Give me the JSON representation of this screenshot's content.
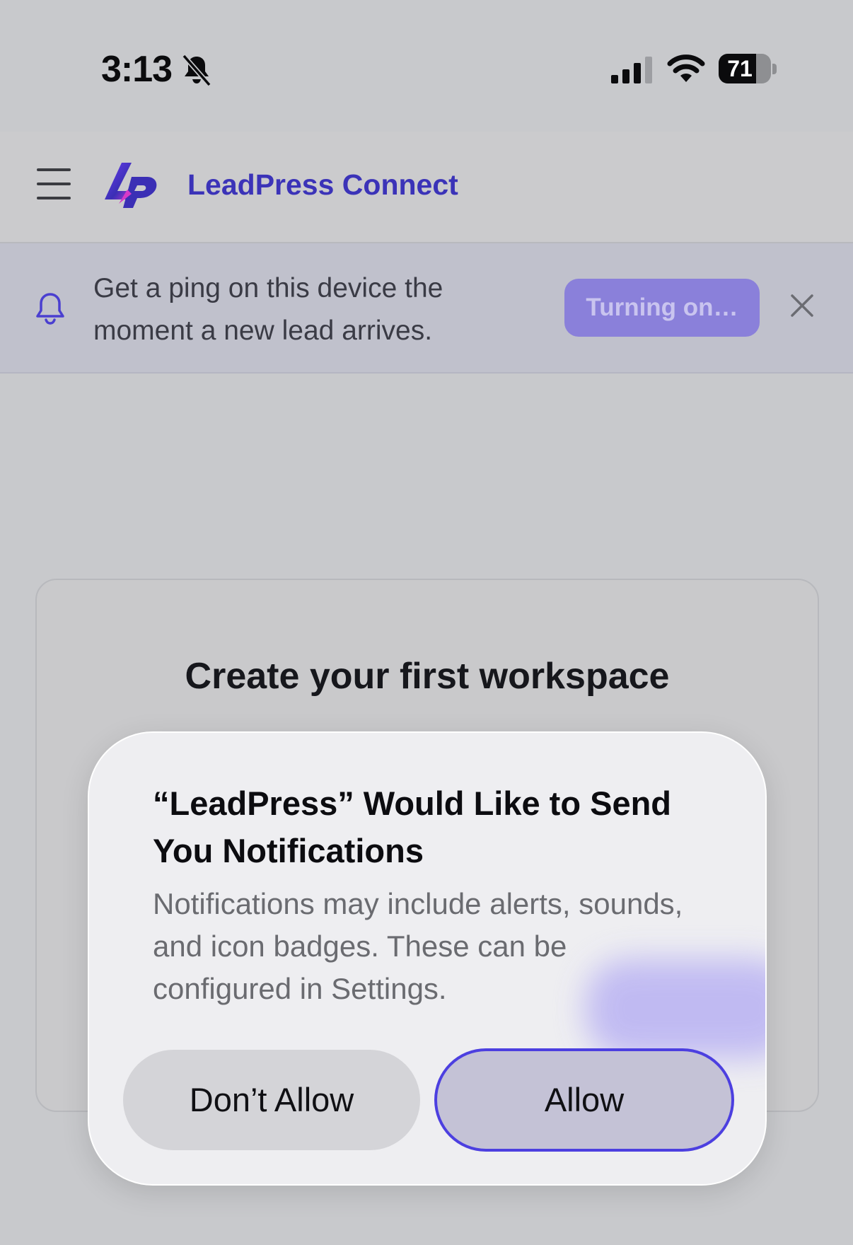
{
  "status_bar": {
    "time": "3:13",
    "battery_level": "71",
    "battery_fraction": 0.71,
    "icons": [
      "bell-slash-icon",
      "signal-icon",
      "wifi-icon",
      "battery-icon"
    ]
  },
  "header": {
    "title": "LeadPress Connect",
    "brand_color": "#3b33b8",
    "icons": [
      "menu-icon",
      "logo-icon"
    ]
  },
  "banner": {
    "message": "Get a ping on this device the moment a new lead arrives.",
    "button_label": "Turning on…",
    "icons": [
      "bell-icon",
      "close-icon"
    ]
  },
  "card": {
    "title": "Create your first workspace"
  },
  "alert": {
    "title": "“LeadPress” Would Like to Send You Notifications",
    "message": "Notifications may include alerts, sounds, and icon badges. These can be configured in Settings.",
    "dont_allow_label": "Don’t Allow",
    "allow_label": "Allow",
    "focus_color": "#4c3fe0"
  }
}
